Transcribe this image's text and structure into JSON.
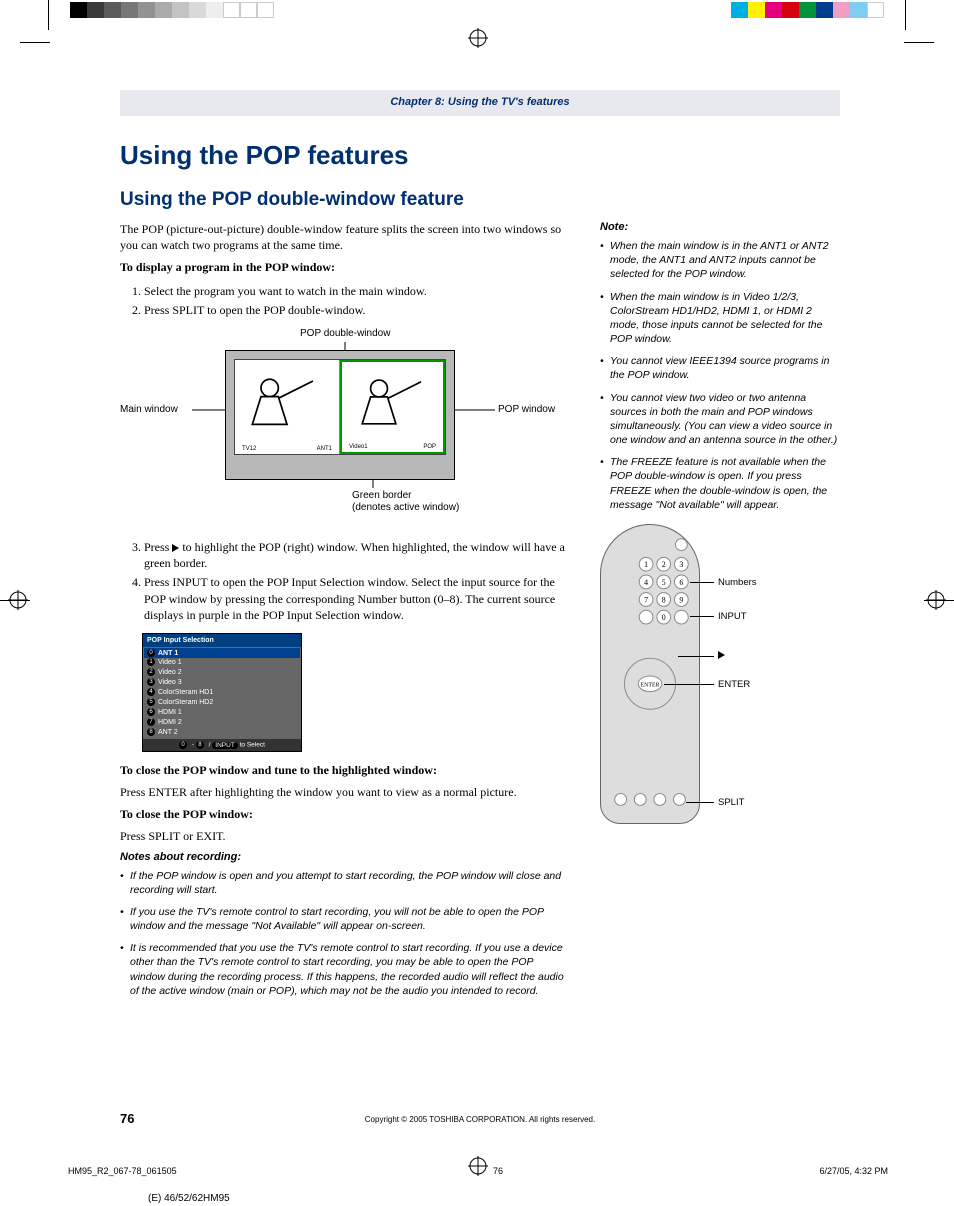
{
  "chapter_head": "Chapter 8: Using the TV's features",
  "h1": "Using the POP features",
  "h2": "Using the POP double-window feature",
  "intro": "The POP (picture-out-picture) double-window feature splits the screen into two windows so you can watch two programs at the same time.",
  "display_head": "To display a program in the POP window:",
  "steps": {
    "s1": "Select the program you want to watch in the main window.",
    "s2": "Press SPLIT to open the POP double-window.",
    "s3a": "Press ",
    "s3b": " to highlight the POP (right) window. When highlighted, the window will have a green border.",
    "s4": "Press INPUT to open the POP Input Selection window. Select the input source for the POP window by pressing the corresponding Number button (0–8). The current source displays in purple in the POP Input Selection window."
  },
  "fig": {
    "top_label": "POP double-window",
    "main": "Main window",
    "pop": "POP window",
    "green": "Green border",
    "green2": "(denotes active window)",
    "ant1": "ANT1",
    "video1": "Video1",
    "poplabel": "POP",
    "tv12": "TV12"
  },
  "pop_menu": {
    "title": "POP Input Selection",
    "items": [
      "ANT 1",
      "Video 1",
      "Video 2",
      "Video 3",
      "ColorSteram HD1",
      "ColorSteram HD2",
      "HDMI 1",
      "HDMI 2",
      "ANT 2"
    ],
    "foot_mid": " - ",
    "foot_slash": " / ",
    "foot_btn": "INPUT",
    "foot_tail": " to Select"
  },
  "close_hl_head": "To close the POP window and tune to the highlighted window:",
  "close_hl": "Press ENTER after highlighting the window you want to view as a normal picture.",
  "close_head": "To close the POP window:",
  "close_txt": "Press SPLIT or EXIT.",
  "notes_rec_head": "Notes about recording:",
  "notes_rec": [
    "If the POP window is open and you attempt to start recording, the POP window will close and recording will start.",
    "If you use the TV's remote control to start recording, you will not be able to open the POP window and the message \"Not Available\" will appear on-screen.",
    "It is recommended that you use the TV's remote control to start recording. If you use a device other than the TV's remote control to start recording, you may be able to open the POP window during the recording process. If this happens, the recorded audio will reflect the audio of the active window (main or POP), which may not be the audio you intended to record."
  ],
  "right_note_head": "Note:",
  "right_notes": [
    "When the main window is in the ANT1 or ANT2 mode, the ANT1 and ANT2 inputs cannot be selected for the POP window.",
    "When the main window is in Video 1/2/3, ColorStream HD1/HD2, HDMI 1, or HDMI 2 mode, those inputs cannot be selected for the POP window.",
    "You cannot view IEEE1394 source programs in the POP window.",
    "You cannot view two video or two antenna sources in both the main and POP windows simultaneously. (You can view a video source in one window and an antenna source in the other.)",
    "The FREEZE feature is not available when the POP double-window is open. If you press FREEZE when the double-window is open, the message \"Not available\" will appear."
  ],
  "remote_labels": {
    "numbers": "Numbers",
    "input": "INPUT",
    "play": "▶",
    "enter": "ENTER",
    "split": "SPLIT"
  },
  "page_num": "76",
  "copyright": "Copyright © 2005 TOSHIBA CORPORATION. All rights reserved.",
  "footer": {
    "file": "HM95_R2_067-78_061505",
    "page": "76",
    "date": "6/27/05, 4:32 PM",
    "model": "(E) 46/52/62HM95"
  },
  "colors_left": [
    "#000",
    "#3a3a3a",
    "#5b5b5b",
    "#777",
    "#929292",
    "#ababab",
    "#c3c3c3",
    "#d9d9d9",
    "#eee",
    "#fff",
    "#fff",
    "#fff"
  ],
  "colors_right": [
    "#00aee6",
    "#fff100",
    "#e4007f",
    "#d7000f",
    "#00943e",
    "#003c8d",
    "#f29ec4",
    "#7ecef4",
    "#fff"
  ]
}
